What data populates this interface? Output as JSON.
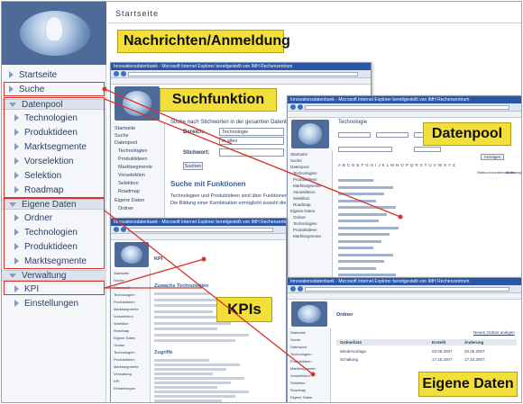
{
  "page": {
    "title": "Startseite"
  },
  "sidebar": {
    "items": [
      {
        "label": "Startseite"
      },
      {
        "label": "Suche"
      },
      {
        "label": "Datenpool"
      },
      {
        "label": "Technologien"
      },
      {
        "label": "Produktideen"
      },
      {
        "label": "Marktsegmente"
      },
      {
        "label": "Vorselektion"
      },
      {
        "label": "Selektion"
      },
      {
        "label": "Roadmap"
      },
      {
        "label": "Eigene Daten"
      },
      {
        "label": "Ordner"
      },
      {
        "label": "Technologien"
      },
      {
        "label": "Produktideen"
      },
      {
        "label": "Marktsegmente"
      },
      {
        "label": "Verwaltung"
      },
      {
        "label": "KPI"
      },
      {
        "label": "Einstellungen"
      }
    ]
  },
  "callouts": {
    "nachrichten": "Nachrichten/Anmeldung",
    "suchfunktion": "Suchfunktion",
    "datenpool": "Datenpool",
    "kpis": "KPIs",
    "eigene_daten": "Eigene Daten"
  },
  "windows": {
    "search": {
      "title": "Innovationsdatenbank - Microsoft Internet Explorer bereitgestellt von IMH Rechenzentrum",
      "intro": "Suche nach Stichworten in der gesamten Datenbank oder nur in ein",
      "bereich_label": "Bereich:",
      "bereich_value": "Technologie",
      "zeitraum_value": "in allen",
      "stichwort_label": "Stichwort:",
      "button": "Suchen",
      "heading": "Suche mit Funktionen",
      "text1": "Technologien und Produktideen sind über Funktionen miteinande",
      "text2": "Die Bildung einer Kombination ermöglicht sowohl die Suche nach",
      "nav": [
        "Startseite",
        "Suche",
        "Datenpool",
        "Technologien",
        "Produktideen",
        "Marktsegmente",
        "Vorselektion",
        "Selektion",
        "Roadmap",
        "Eigene Daten",
        "Ordner"
      ]
    },
    "datenpool": {
      "title": "Innovationsdatenbank - Microsoft Internet Explorer bereitgestellt von IMH Rechenzentrum",
      "heading": "Technologie",
      "letters": "A B C D E F G H I J K L M N O P Q R S T U V W X Y Z",
      "button": "Anzeigen",
      "col_status": "Status",
      "col_innovation": "Innovationsstatus",
      "col_aenderung": "Änderung",
      "nav": [
        "Startseite",
        "Suche",
        "Datenpool",
        "Technologien",
        "Produktideen",
        "Marktsegmente",
        "Vorselektion",
        "Selektion",
        "Roadmap",
        "Eigene Daten",
        "Ordner",
        "Technologien",
        "Produktideen",
        "Marktsegmente"
      ]
    },
    "kpi": {
      "title": "Innovationsdatenbank - Microsoft Internet Explorer bereitgestellt von IMH Rechenzentrum",
      "heading": "KPI",
      "section1": "Zuwachs Technologien",
      "section2": "Zugriffe",
      "nav": [
        "Startseite",
        "Suche",
        "Datenpool",
        "Technologien",
        "Produktideen",
        "Marktsegmente",
        "Vorselektion",
        "Selektion",
        "Roadmap",
        "Eigene Daten",
        "Ordner",
        "Technologien",
        "Produktideen",
        "Marktsegmente",
        "Verwaltung",
        "KPI",
        "Einstellungen"
      ]
    },
    "ordner": {
      "title": "Innovationsdatenbank - Microsoft Internet Explorer bereitgestellt von IMH Rechenzentrum",
      "heading": "Ordner",
      "link": "Neuen Ordner anlegen",
      "col_name": "Ordnerliste",
      "col_date": "Erstellt",
      "col_change": "Änderung",
      "rows": [
        {
          "name": "Wiedervorlage",
          "created": "03.05.2007",
          "changed": "03.05.2007"
        },
        {
          "name": "Schaltung",
          "created": "17.10.2007",
          "changed": "17.10.2007"
        }
      ],
      "nav": [
        "Startseite",
        "Suche",
        "Datenpool",
        "Technologien",
        "Produktideen",
        "Marktsegmente",
        "Vorselektion",
        "Selektion",
        "Roadmap",
        "Eigene Daten"
      ]
    }
  }
}
